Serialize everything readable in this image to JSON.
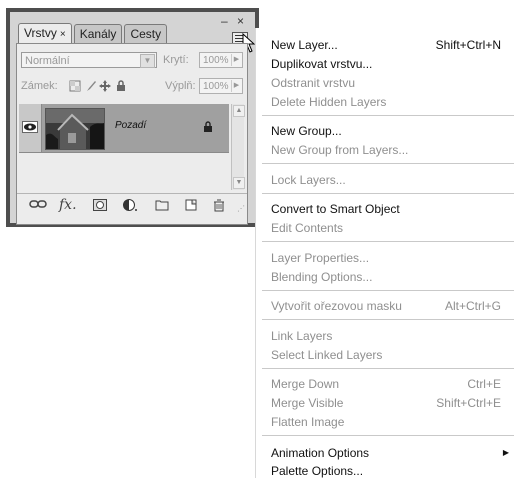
{
  "panel": {
    "tabs": [
      {
        "label": "Vrstvy",
        "close": "×"
      },
      {
        "label": "Kanály"
      },
      {
        "label": "Cesty"
      }
    ],
    "window_buttons": "– ×",
    "blend_mode": "Normální",
    "opacity_label": "Krytí:",
    "opacity_value": "100%",
    "lock_label": "Zámek:",
    "fill_label": "Výplň:",
    "fill_value": "100%",
    "layers": [
      {
        "name": "Pozadí",
        "visible": true,
        "locked": true
      }
    ],
    "bottom_icons": [
      "link-icon",
      "fx-icon",
      "mask-icon",
      "adjustment-icon",
      "group-folder-icon",
      "new-layer-icon",
      "trash-icon"
    ]
  },
  "menu": {
    "items": [
      {
        "label": "New Layer...",
        "shortcut": "Shift+Ctrl+N",
        "disabled": false
      },
      {
        "label": "Duplikovat vrstvu...",
        "shortcut": "",
        "disabled": false
      },
      {
        "label": "Odstranit vrstvu",
        "shortcut": "",
        "disabled": true
      },
      {
        "label": "Delete Hidden Layers",
        "shortcut": "",
        "disabled": true
      },
      {
        "label": "New Group...",
        "shortcut": "",
        "disabled": false
      },
      {
        "label": "New Group from Layers...",
        "shortcut": "",
        "disabled": true
      },
      {
        "label": "Lock Layers...",
        "shortcut": "",
        "disabled": true
      },
      {
        "label": "Convert to Smart Object",
        "shortcut": "",
        "disabled": false
      },
      {
        "label": "Edit Contents",
        "shortcut": "",
        "disabled": true
      },
      {
        "label": "Layer Properties...",
        "shortcut": "",
        "disabled": true
      },
      {
        "label": "Blending Options...",
        "shortcut": "",
        "disabled": true
      },
      {
        "label": "Vytvořit ořezovou masku",
        "shortcut": "Alt+Ctrl+G",
        "disabled": true
      },
      {
        "label": "Link Layers",
        "shortcut": "",
        "disabled": true
      },
      {
        "label": "Select Linked Layers",
        "shortcut": "",
        "disabled": true
      },
      {
        "label": "Merge Down",
        "shortcut": "Ctrl+E",
        "disabled": true
      },
      {
        "label": "Merge Visible",
        "shortcut": "Shift+Ctrl+E",
        "disabled": true
      },
      {
        "label": "Flatten Image",
        "shortcut": "",
        "disabled": true
      },
      {
        "label": "Animation Options",
        "shortcut": "",
        "disabled": false,
        "submenu": "▶"
      },
      {
        "label": "Palette Options...",
        "shortcut": "",
        "disabled": false
      }
    ]
  },
  "colors": {
    "panel_border": "#4e4e4e",
    "panel_bg": "#d4d4d4",
    "selected_layer": "#a0a0a0",
    "menu_disabled_text": "#8f8f8f"
  }
}
